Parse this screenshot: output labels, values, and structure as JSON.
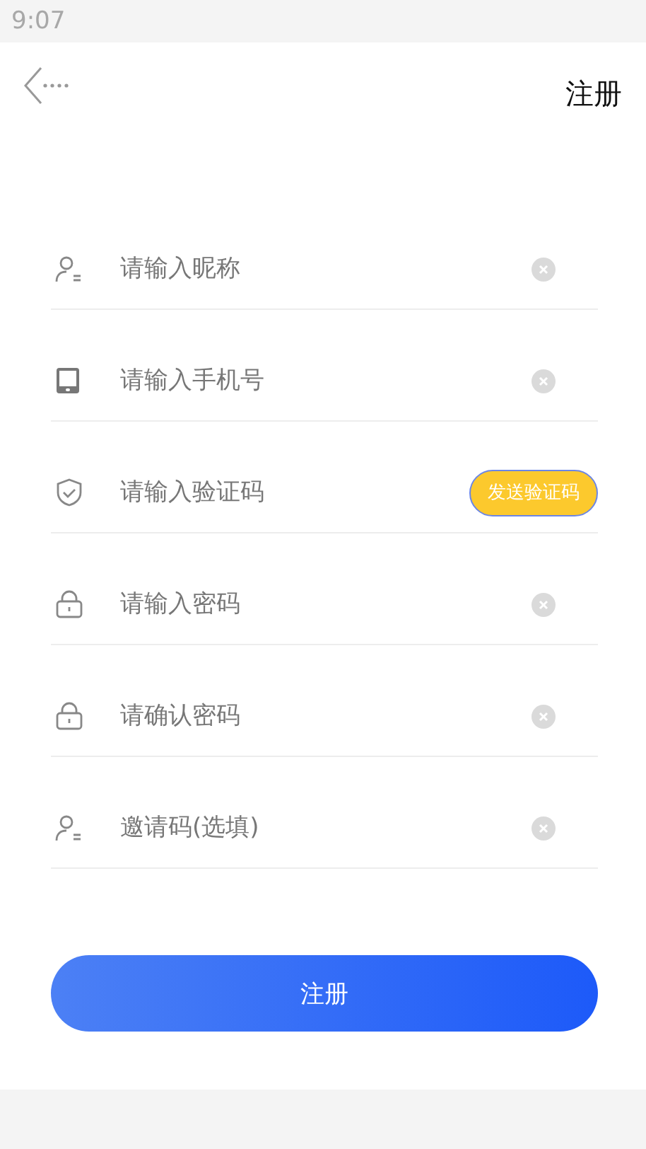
{
  "status_bar": {
    "time": "9:07"
  },
  "header": {
    "title": "注册"
  },
  "fields": [
    {
      "placeholder": "请输入昵称",
      "kind": "clear"
    },
    {
      "placeholder": "请输入手机号",
      "kind": "clear"
    },
    {
      "placeholder": "请输入验证码",
      "kind": "send",
      "action": "发送验证码"
    },
    {
      "placeholder": "请输入密码",
      "kind": "clear"
    },
    {
      "placeholder": "请确认密码",
      "kind": "clear"
    },
    {
      "placeholder": "邀请码(选填)",
      "kind": "clear"
    }
  ],
  "submit": "注册"
}
